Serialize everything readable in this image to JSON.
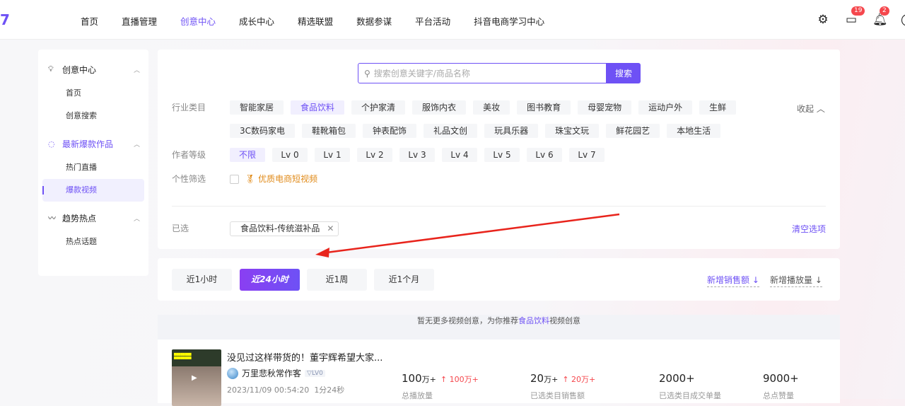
{
  "header": {
    "logo": "7",
    "nav": [
      "首页",
      "直播管理",
      "创意中心",
      "成长中心",
      "精选联盟",
      "数据参谋",
      "平台活动",
      "抖音电商学习中心"
    ],
    "active_nav": "创意中心",
    "messages_badge": "19",
    "notifications_badge": "2",
    "icons": [
      "gear-icon",
      "message-icon",
      "bell-icon"
    ]
  },
  "sidebar": {
    "groups": [
      {
        "label": "创意中心",
        "icon": "lightbulb-icon",
        "items": [
          "首页",
          "创意搜索"
        ]
      },
      {
        "label": "最新爆款作品",
        "icon": "flame-icon",
        "items": [
          "热门直播",
          "爆款视频"
        ]
      },
      {
        "label": "趋势热点",
        "icon": "trend-icon",
        "items": [
          "热点话题"
        ]
      }
    ],
    "active_item": "爆款视频"
  },
  "search": {
    "placeholder": "搜索创意关键字/商品名称",
    "button": "搜索"
  },
  "filters": {
    "industry_label": "行业类目",
    "industry": [
      "智能家居",
      "食品饮料",
      "个护家清",
      "服饰内衣",
      "美妆",
      "图书教育",
      "母婴宠物",
      "运动户外",
      "生鲜",
      "3C数码家电",
      "鞋靴箱包",
      "钟表配饰",
      "礼品文创",
      "玩具乐器",
      "珠宝文玩",
      "鲜花园艺",
      "本地生活"
    ],
    "industry_selected": "食品饮料",
    "collapse": "收起",
    "level_label": "作者等级",
    "levels": [
      "不限",
      "Lv 0",
      "Lv 1",
      "Lv 2",
      "Lv 3",
      "Lv 4",
      "Lv 5",
      "Lv 6",
      "Lv 7"
    ],
    "level_selected": "不限",
    "personal_label": "个性筛选",
    "quality_video": "优质电商短视频",
    "quality_checked": false,
    "selected_label": "已选",
    "selected_tag": "食品饮料-传统滋补品",
    "clear": "清空选项"
  },
  "time_tabs": {
    "tabs": [
      "近1小时",
      "近24小时",
      "近1周",
      "近1个月"
    ],
    "active": "近24小时",
    "sort": [
      "新增销售额",
      "新增播放量"
    ],
    "sort_active": "新增销售额"
  },
  "empty": {
    "prefix": "暂无更多视频创意，为你推荐",
    "category": "食品饮料",
    "suffix": "视频创意"
  },
  "video": {
    "title": "没见过这样带货的！董宇辉希望大家...",
    "author": "万里悲秋常作客",
    "level": "LV0",
    "datetime": "2023/11/09 00:54:20",
    "duration": "1分24秒",
    "stats": [
      {
        "value": "100",
        "unit": "万+",
        "delta": "100万+",
        "label": "总播放量"
      },
      {
        "value": "20",
        "unit": "万+",
        "delta": "20万+",
        "label": "已选类目销售额"
      },
      {
        "value": "2000+",
        "unit": "",
        "delta": "",
        "label": "已选类目成交单量"
      },
      {
        "value": "9000+",
        "unit": "",
        "delta": "",
        "label": "总点赞量"
      }
    ]
  },
  "colors": {
    "accent": "#6e51f5",
    "badge": "#f5474d",
    "annotation_arrow": "#e8241c"
  }
}
